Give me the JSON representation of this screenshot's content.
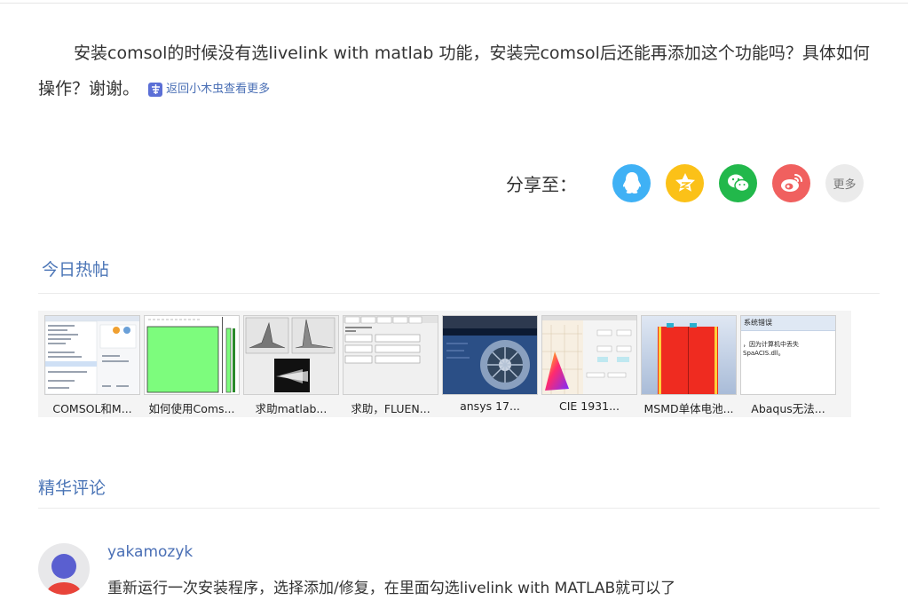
{
  "question": {
    "text": "安装comsol的时候没有选livelink with matlab 功能，安装完comsol后还能再添加这个功能吗？具体如何操作？谢谢。",
    "back_link": "返回小木虫查看更多"
  },
  "share": {
    "label": "分享至：",
    "buttons": [
      {
        "name": "qq",
        "icon": "qq-penguin-icon",
        "color": "#3fb1f5"
      },
      {
        "name": "qzone",
        "icon": "qzone-star-icon",
        "color": "#fbc118"
      },
      {
        "name": "wechat",
        "icon": "wechat-icon",
        "color": "#22b84b"
      },
      {
        "name": "weibo",
        "icon": "weibo-icon",
        "color": "#f0605f"
      }
    ],
    "more_label": "更多"
  },
  "hot_posts": {
    "title": "今日热帖",
    "items": [
      {
        "label": "COMSOL和M..."
      },
      {
        "label": "如何使用Coms..."
      },
      {
        "label": "求助matlab..."
      },
      {
        "label": "求助，FLUEN..."
      },
      {
        "label": "ansys 17..."
      },
      {
        "label": "CIE 1931..."
      },
      {
        "label": "MSMD单体电池..."
      },
      {
        "label": "Abaqus无法..."
      }
    ]
  },
  "featured_comments": {
    "title": "精华评论",
    "comments": [
      {
        "user": "yakamozyk",
        "text": "重新运行一次安装程序，选择添加/修复，在里面勾选livelink with MATLAB就可以了"
      }
    ]
  },
  "thumb_text": {
    "dialog_title": "系统错误",
    "dialog_body": "，因为计算机中丢失 SpaACIS.dll。"
  }
}
